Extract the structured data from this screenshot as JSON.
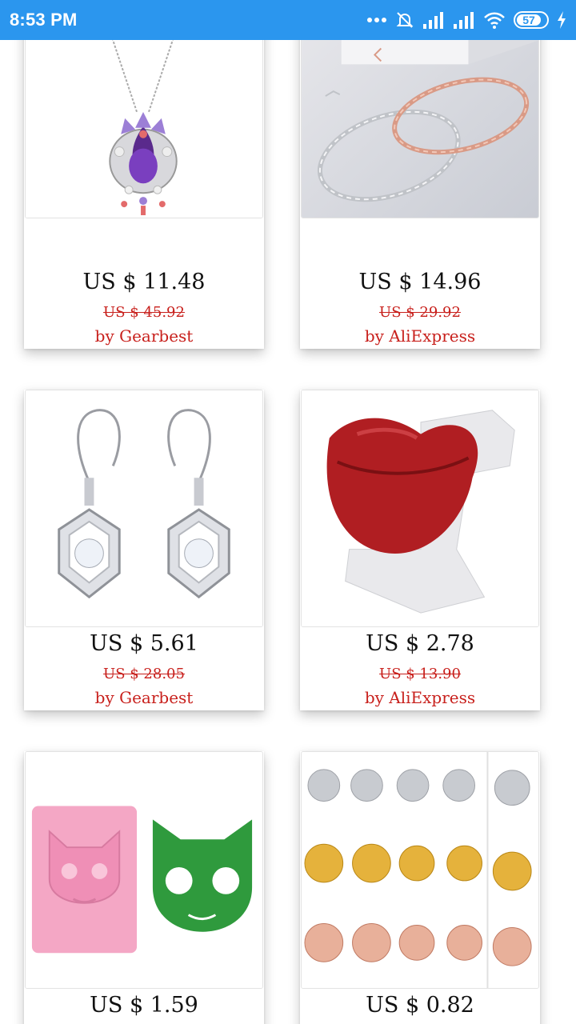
{
  "status_bar": {
    "time": "8:53 PM",
    "battery_level": "57",
    "icons": [
      "more-dots-icon",
      "mute-icon",
      "signal-icon",
      "signal-icon",
      "wifi-icon",
      "battery-icon",
      "charging-icon"
    ]
  },
  "colors": {
    "status_bar": "#2b96ee",
    "seller_text": "#c8201c"
  },
  "products": [
    {
      "price": "US $ 11.48",
      "original_price": "US $ 45.92",
      "seller": "by Gearbest",
      "image": "amethyst-pendant-necklace"
    },
    {
      "price": "US $ 14.96",
      "original_price": "US $ 29.92",
      "seller": "by AliExpress",
      "image": "twisted-bracelets"
    },
    {
      "price": "US $ 5.61",
      "original_price": "US $ 28.05",
      "seller": "by Gearbest",
      "image": "cube-crystal-earrings"
    },
    {
      "price": "US $ 2.78",
      "original_price": "US $ 13.90",
      "seller": "by AliExpress",
      "image": "red-lips-ring"
    },
    {
      "price": "US $ 1.59",
      "original_price": "",
      "seller": "",
      "image": "cat-keychain-mold"
    },
    {
      "price": "US $ 0.82",
      "original_price": "",
      "seller": "",
      "image": "earring-backs-assortment"
    }
  ]
}
